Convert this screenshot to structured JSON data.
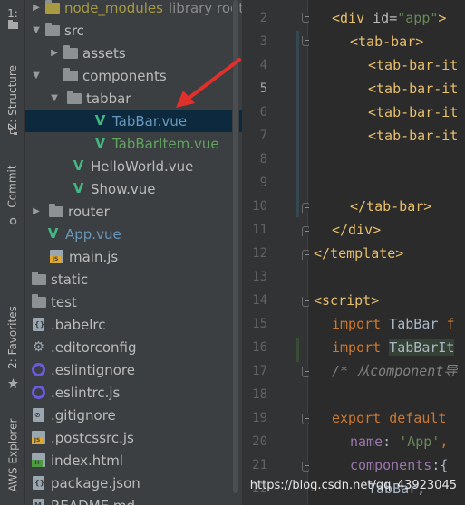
{
  "toolstrip": {
    "tabs": [
      {
        "label": "1:",
        "icon": "folder-icon"
      },
      {
        "label": "Z: Structure",
        "icon": "structure-icon"
      },
      {
        "label": "Commit",
        "icon": "commit-icon"
      },
      {
        "label": "2: Favorites",
        "icon": "star-icon"
      },
      {
        "label": "AWS Explorer",
        "icon": "aws-icon"
      }
    ]
  },
  "project_tree": {
    "items": [
      {
        "label": "node_modules",
        "hint": "library root",
        "type": "folder",
        "depth": 0,
        "expanded": false
      },
      {
        "label": "src",
        "type": "folder",
        "depth": 0,
        "expanded": true
      },
      {
        "label": "assets",
        "type": "folder",
        "depth": 1,
        "expanded": false
      },
      {
        "label": "components",
        "type": "folder",
        "depth": 1,
        "expanded": true
      },
      {
        "label": "tabbar",
        "type": "folder",
        "depth": 2,
        "expanded": true
      },
      {
        "label": "TabBar.vue",
        "type": "vue",
        "depth": 3,
        "selected": true
      },
      {
        "label": "TabBarItem.vue",
        "type": "vue",
        "depth": 3
      },
      {
        "label": "HelloWorld.vue",
        "type": "vue",
        "depth": 2
      },
      {
        "label": "Show.vue",
        "type": "vue",
        "depth": 2
      },
      {
        "label": "router",
        "type": "folder",
        "depth": 1,
        "expanded": false
      },
      {
        "label": "App.vue",
        "type": "vue",
        "depth": 1
      },
      {
        "label": "main.js",
        "type": "js",
        "depth": 1
      },
      {
        "label": "static",
        "type": "folder",
        "depth": 0
      },
      {
        "label": "test",
        "type": "folder",
        "depth": 0
      },
      {
        "label": ".babelrc",
        "type": "config",
        "depth": 0
      },
      {
        "label": ".editorconfig",
        "type": "gear",
        "depth": 0
      },
      {
        "label": ".eslintignore",
        "type": "eslint",
        "depth": 0
      },
      {
        "label": ".eslintrc.js",
        "type": "eslint",
        "depth": 0
      },
      {
        "label": ".gitignore",
        "type": "ignore",
        "depth": 0
      },
      {
        "label": ".postcssrc.js",
        "type": "js",
        "depth": 0
      },
      {
        "label": "index.html",
        "type": "html",
        "depth": 0
      },
      {
        "label": "package.json",
        "type": "config",
        "depth": 0
      },
      {
        "label": "README.md",
        "type": "md",
        "depth": 0
      }
    ]
  },
  "editor": {
    "line_numbers": [
      "2",
      "3",
      "4",
      "5",
      "6",
      "7",
      "8",
      "9",
      "10",
      "11",
      "12",
      "13",
      "14",
      "15",
      "16",
      "17",
      "18",
      "19",
      "20",
      "21",
      "22"
    ],
    "active_line": "5",
    "lines": {
      "l2a": "<div ",
      "l2b": "id",
      "l2c": "=",
      "l2d": "\"app\"",
      "l2e": ">",
      "l3": "<tab-bar>",
      "l4": "<tab-bar-it",
      "l5": "<tab-bar-it",
      "l6": "<tab-bar-it",
      "l7": "<tab-bar-it",
      "l10": "</tab-bar>",
      "l11": "</div>",
      "l12": "</template>",
      "l14": "<script>",
      "l15a": "import ",
      "l15b": "TabBar ",
      "l15c": "f",
      "l16a": "import ",
      "l16b": "TabBarIt",
      "l17": "/* 从component导",
      "l19a": "export ",
      "l19b": "default",
      "l20a": "name",
      "l20b": ": ",
      "l20c": "'App'",
      "l20d": ",",
      "l21a": "components",
      "l21b": ":{",
      "l22": "TabBar,"
    }
  },
  "watermark": "https://blog.csdn.net/qq_43923045",
  "colors": {
    "background": "#2b2b2b",
    "panel": "#3c3f41",
    "selection": "#0d293e",
    "tag": "#e8bf6a",
    "keyword": "#cc7832",
    "string": "#6a8759",
    "vue": "#41b883",
    "arrow": "#e0302b"
  }
}
